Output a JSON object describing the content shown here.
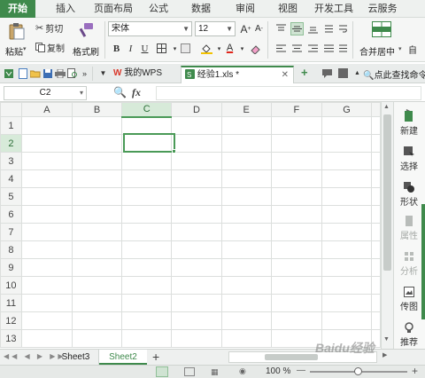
{
  "menu": {
    "tabs": [
      {
        "label": "开始"
      },
      {
        "label": "插入"
      },
      {
        "label": "页面布局"
      },
      {
        "label": "公式"
      },
      {
        "label": "数据"
      },
      {
        "label": "审阅"
      },
      {
        "label": "视图"
      },
      {
        "label": "开发工具"
      },
      {
        "label": "云服务"
      }
    ]
  },
  "ribbon": {
    "paste_label": "粘贴",
    "cut_label": "剪切",
    "copy_label": "复制",
    "format_painter_label": "格式刷",
    "font_name": "宋体",
    "font_size": "12",
    "bold": "B",
    "italic": "I",
    "underline": "U",
    "font_color_glyph": "A",
    "merge_label": "合并居中",
    "autowrap_label": "自"
  },
  "tabbar": {
    "home_tab": "我的WPS",
    "doc_tab": "经验1.xls *",
    "new_tab_glyph": "+",
    "search_label": "点此查找命令"
  },
  "formula": {
    "name_box": "C2",
    "fx": "fx"
  },
  "grid": {
    "columns": [
      "A",
      "B",
      "C",
      "D",
      "E",
      "F",
      "G"
    ],
    "rows": [
      "1",
      "2",
      "3",
      "4",
      "5",
      "6",
      "7",
      "8",
      "9",
      "10",
      "11",
      "12",
      "13"
    ],
    "selected_column": "C",
    "selected_row": "2"
  },
  "right_pane": {
    "items": [
      {
        "label": "新建"
      },
      {
        "label": "选择"
      },
      {
        "label": "形状"
      },
      {
        "label": "属性"
      },
      {
        "label": "分析"
      },
      {
        "label": "传图"
      },
      {
        "label": "推荐"
      }
    ]
  },
  "sheets": {
    "tabs": [
      {
        "label": "Sheet3"
      },
      {
        "label": "Sheet2"
      }
    ],
    "add_glyph": "+"
  },
  "status": {
    "zoom": "100 %",
    "zoom_minus": "—",
    "zoom_plus": "+"
  },
  "watermark": "Baidu经验",
  "colors": {
    "accent": "#3f8a4c",
    "selection": "#4a9a57",
    "header_selected": "#d7ead9"
  }
}
